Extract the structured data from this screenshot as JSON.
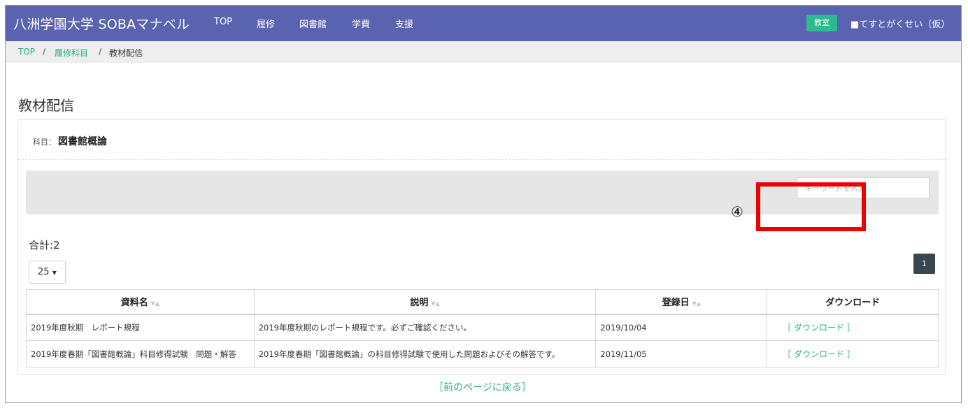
{
  "header": {
    "brand": "八洲学園大学 SOBAマナベル",
    "nav": [
      "TOP",
      "履修",
      "図書館",
      "学費",
      "支援"
    ],
    "role_badge": "教室",
    "user": "■てすとがくせい（仮）"
  },
  "breadcrumb": {
    "items": [
      "TOP",
      "履修科目",
      "教材配信"
    ],
    "separator": "/"
  },
  "page": {
    "title": "教材配信",
    "subject_label": "科目：",
    "subject_value": "図書館概論",
    "search_placeholder": "キーワードを入力",
    "total": "合計:2",
    "page_size": "25",
    "current_page": "1"
  },
  "table": {
    "columns": [
      "資料名",
      "説明",
      "登録日",
      "ダウンロード"
    ],
    "rows": [
      {
        "name": "2019年度秋期　レポート規程",
        "description": "2019年度秋期のレポート規程です。必ずご確認ください。",
        "date": "2019/10/04",
        "download": "［ ダウンロード ］"
      },
      {
        "name": "2019年度春期「図書館概論」科目修得試験　問題・解答",
        "description": "2019年度春期「図書館概論」の科目修得試験で使用した問題およびその解答です。",
        "date": "2019/11/05",
        "download": "［ ダウンロード ］"
      }
    ]
  },
  "annotation": {
    "step_marker": "④",
    "highlight_color": "#ec0000"
  },
  "footer": {
    "back_link": "［前のページに戻る］"
  },
  "colors": {
    "navbar": "#5a63b0",
    "accent_green": "#2bae8a",
    "role_badge": "#2dbb8d",
    "pager": "#3a4650"
  },
  "icons": {
    "download": "download-icon",
    "sort": "sort-icon",
    "caret": "caret-down-icon"
  }
}
